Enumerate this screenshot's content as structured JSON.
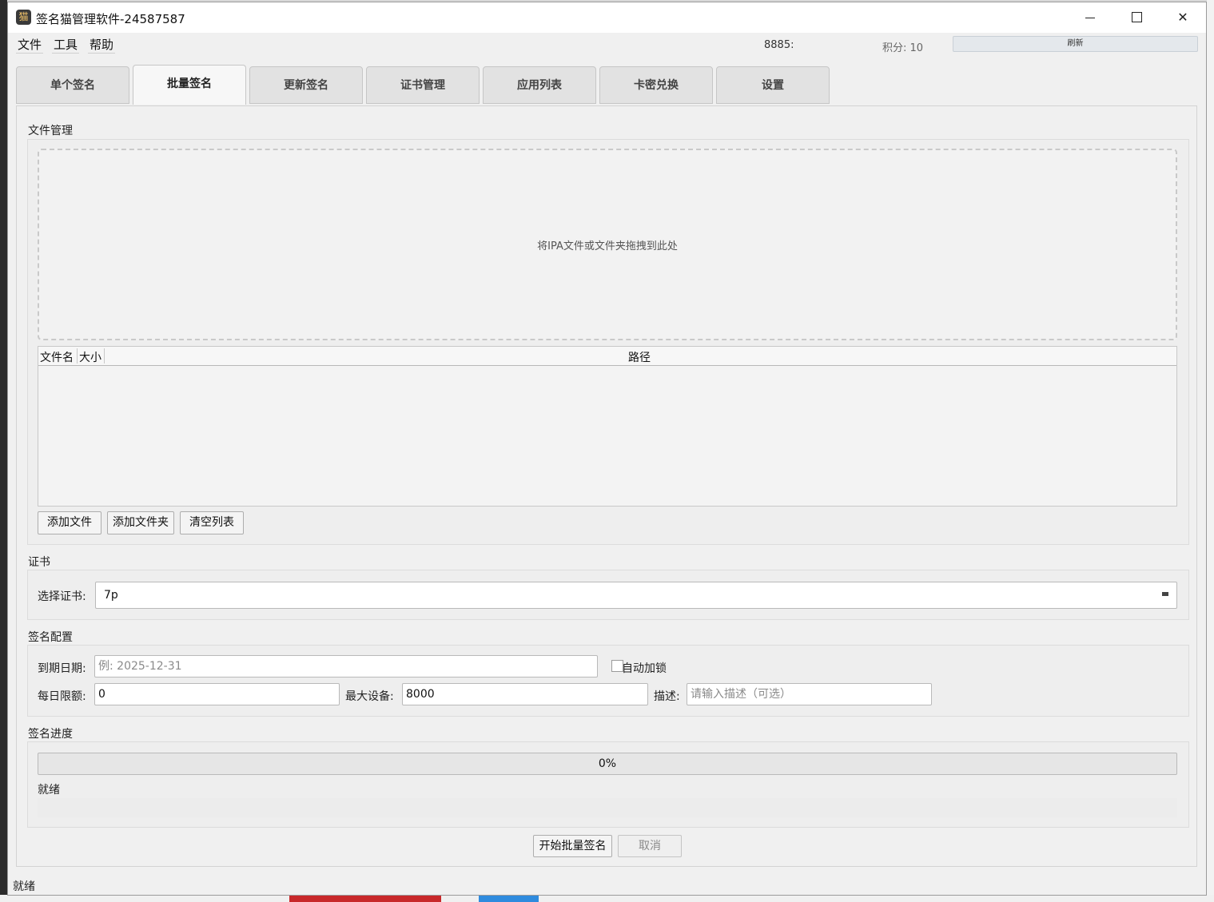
{
  "window": {
    "title": "签名猫管理软件-24587587",
    "app_icon_glyph": "猫"
  },
  "menu": [
    "文件",
    "工具",
    "帮助"
  ],
  "header": {
    "id_label": "8885:",
    "score_label": "积分: 10",
    "refresh_label": "刷新"
  },
  "tabs": [
    {
      "label": "单个签名",
      "active": false
    },
    {
      "label": "批量签名",
      "active": true
    },
    {
      "label": "更新签名",
      "active": false
    },
    {
      "label": "证书管理",
      "active": false
    },
    {
      "label": "应用列表",
      "active": false
    },
    {
      "label": "卡密兑换",
      "active": false
    },
    {
      "label": "设置",
      "active": false
    }
  ],
  "file_section": {
    "title": "文件管理",
    "drop_hint": "将IPA文件或文件夹拖拽到此处",
    "columns": [
      "文件名",
      "大小",
      "路径"
    ],
    "rows": [],
    "buttons": {
      "add_file": "添加文件",
      "add_folder": "添加文件夹",
      "clear_list": "清空列表"
    }
  },
  "cert_section": {
    "title": "证书",
    "select_label": "选择证书:",
    "selected_value": "7p"
  },
  "config_section": {
    "title": "签名配置",
    "expiry_label": "到期日期:",
    "expiry_placeholder": "例: 2025-12-31",
    "auto_lock_label": "自动加锁",
    "auto_lock_checked": false,
    "daily_limit_label": "每日限额:",
    "daily_limit_value": "0",
    "max_devices_label": "最大设备:",
    "max_devices_value": "8000",
    "desc_label": "描述:",
    "desc_placeholder": "请输入描述（可选）"
  },
  "progress_section": {
    "title": "签名进度",
    "percent": 0,
    "percent_text": "0%",
    "status_text": "就绪"
  },
  "actions": {
    "start_label": "开始批量签名",
    "cancel_label": "取消"
  },
  "status_bar": "就绪",
  "colors": {
    "progress_fill": "#4aa3df"
  }
}
